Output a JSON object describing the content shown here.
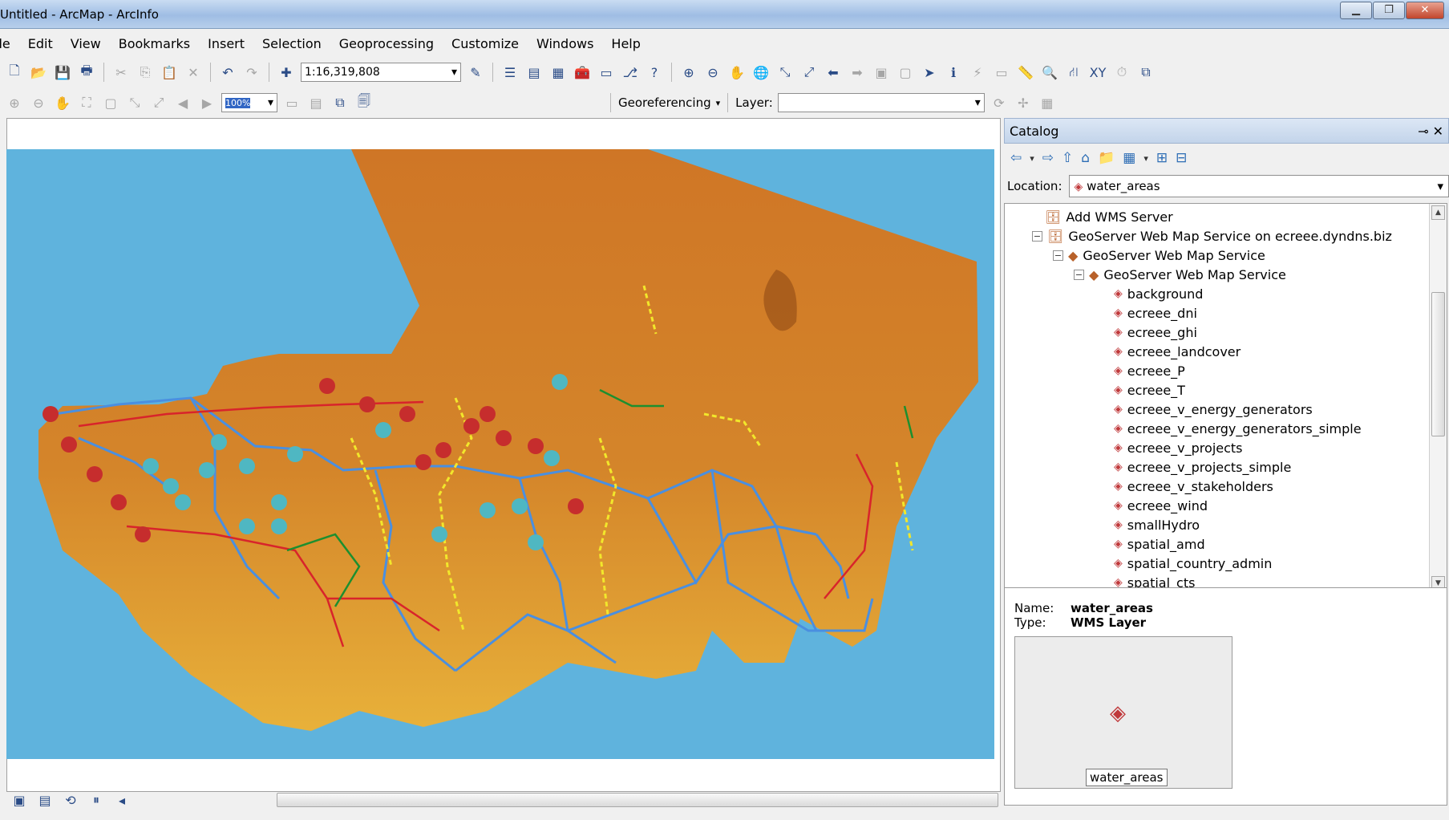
{
  "window": {
    "title": "Untitled - ArcMap - ArcInfo"
  },
  "menu": [
    "File",
    "Edit",
    "View",
    "Bookmarks",
    "Insert",
    "Selection",
    "Geoprocessing",
    "Customize",
    "Windows",
    "Help"
  ],
  "toolbar": {
    "scale": "1:16,319,808",
    "zoom_percent": "100%"
  },
  "georef": {
    "label": "Georeferencing",
    "layer_label": "Layer:",
    "layer_value": ""
  },
  "catalog": {
    "title": "Catalog",
    "location_label": "Location:",
    "location_value": "water_areas",
    "tree": {
      "add_wms": "Add WMS Server",
      "wms_connection": "GeoServer Web Map Service on ecreee.dyndns.biz",
      "service": "GeoServer Web Map Service",
      "service_group": "GeoServer Web Map Service",
      "layers": [
        "background",
        "ecreee_dni",
        "ecreee_ghi",
        "ecreee_landcover",
        "ecreee_P",
        "ecreee_T",
        "ecreee_v_energy_generators",
        "ecreee_v_energy_generators_simple",
        "ecreee_v_projects",
        "ecreee_v_projects_simple",
        "ecreee_v_stakeholders",
        "ecreee_wind",
        "smallHydro",
        "spatial_amd",
        "spatial_country_admin",
        "spatial_cts"
      ]
    },
    "details": {
      "name_label": "Name:",
      "name_value": "water_areas",
      "type_label": "Type:",
      "type_value": "WMS Layer",
      "thumbnail_caption": "water_areas"
    }
  },
  "colors": {
    "sea": "#5fb3dd",
    "land_dark": "#c76a1f",
    "land_light": "#e9b43a",
    "grid_blue": "#4a8fe0",
    "grid_red": "#d8242b",
    "grid_yellow": "#f2e72b",
    "grid_green": "#1d8f2f"
  }
}
